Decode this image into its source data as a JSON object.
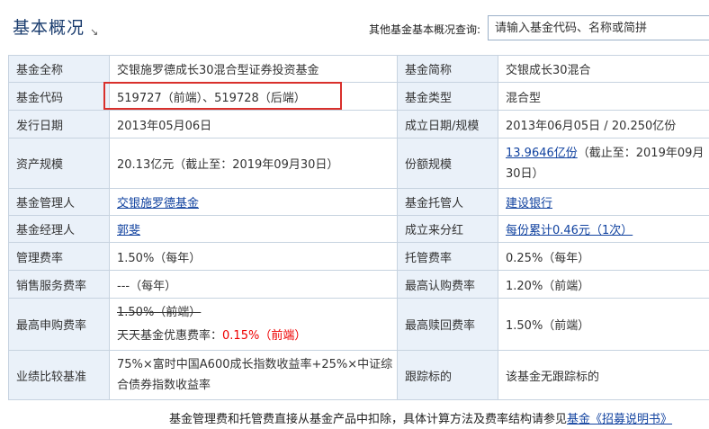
{
  "header": {
    "title": "基本概况",
    "title_arrow": "↘",
    "search_label": "其他基金基本概况查询:",
    "search_placeholder": "请输入基金代码、名称或简拼"
  },
  "rows": {
    "full_name": {
      "k": "基金全称",
      "v": "交银施罗德成长30混合型证券投资基金"
    },
    "short_name": {
      "k": "基金简称",
      "v": "交银成长30混合"
    },
    "code": {
      "k": "基金代码",
      "v": "519727（前端）、519728（后端）"
    },
    "type": {
      "k": "基金类型",
      "v": "混合型"
    },
    "issue_date": {
      "k": "发行日期",
      "v": "2013年05月06日"
    },
    "found": {
      "k": "成立日期/规模",
      "v": "2013年06月05日 / 20.250亿份"
    },
    "assets": {
      "k": "资产规模",
      "v": "20.13亿元（截止至：2019年09月30日）"
    },
    "shares": {
      "k": "份额规模",
      "link": "13.9646亿份",
      "rest1": "（截止至：2019年09月",
      "rest2": "30日）"
    },
    "manager_co": {
      "k": "基金管理人",
      "v": "交银施罗德基金"
    },
    "custodian": {
      "k": "基金托管人",
      "v": "建设银行"
    },
    "manager": {
      "k": "基金经理人",
      "v": "郭斐"
    },
    "dividend": {
      "k": "成立来分红",
      "v": "每份累计0.46元（1次）"
    },
    "mgmt_fee": {
      "k": "管理费率",
      "v": "1.50%（每年）"
    },
    "custody_fee": {
      "k": "托管费率",
      "v": "0.25%（每年）"
    },
    "sales_fee": {
      "k": "销售服务费率",
      "v": "---（每年）"
    },
    "max_sub": {
      "k": "最高认购费率",
      "v": "1.20%（前端）"
    },
    "max_purchase": {
      "k": "最高申购费率",
      "orig": "1.50%（前端）",
      "tt_label": "天天基金优惠费率：",
      "tt_val": "0.15%（前端）"
    },
    "max_redeem": {
      "k": "最高赎回费率",
      "v": "1.50%（前端）"
    },
    "benchmark": {
      "k": "业绩比较基准",
      "v1": "75%×富时中国A600成长指数收益率+25%×中证综",
      "v2": "合债券指数收益率"
    },
    "tracking": {
      "k": "跟踪标的",
      "v": "该基金无跟踪标的"
    }
  },
  "footer": {
    "text": "基金管理费和托管费直接从基金产品中扣除，具体计算方法及费率结构请参见",
    "link": "基金《招募说明书》"
  },
  "colors": {
    "label_bg": "#eaf1f9",
    "border": "#c7d3e0",
    "link": "#1243a0",
    "highlight": "#d9302c",
    "discount": "#ee0000"
  }
}
